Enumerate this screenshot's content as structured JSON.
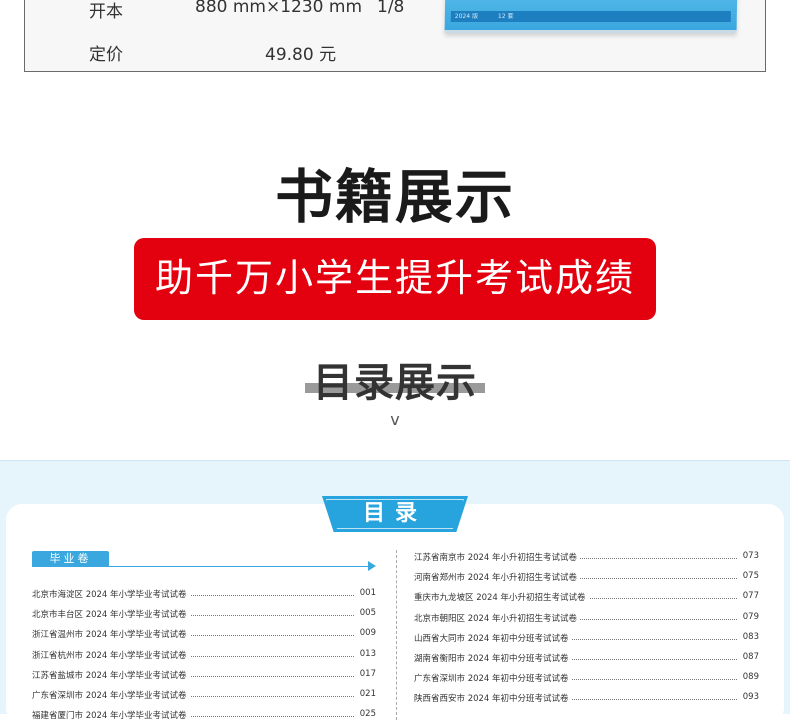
{
  "spec": {
    "rows": [
      {
        "label": "开本",
        "value1": "880 mm×1230 mm",
        "value2": "1/8"
      },
      {
        "label": "定价",
        "value1": "49.80 元"
      }
    ]
  },
  "book_thumb": {
    "strip_text_1": "2024 版",
    "strip_text_2": "12 套"
  },
  "headings": {
    "title": "书籍展示",
    "banner": "助千万小学生提升考试成绩",
    "subtitle": "目录展示",
    "chevron": "v"
  },
  "toc": {
    "badge": "目录",
    "section": "毕业卷",
    "left": [
      {
        "title": "北京市海淀区 2024 年小学毕业考试试卷",
        "page": "001"
      },
      {
        "title": "北京市丰台区 2024 年小学毕业考试试卷",
        "page": "005"
      },
      {
        "title": "浙江省温州市 2024 年小学毕业考试试卷",
        "page": "009"
      },
      {
        "title": "浙江省杭州市 2024 年小学毕业考试试卷",
        "page": "013"
      },
      {
        "title": "江苏省盐城市 2024 年小学毕业考试试卷",
        "page": "017"
      },
      {
        "title": "广东省深圳市 2024 年小学毕业考试试卷",
        "page": "021"
      },
      {
        "title": "福建省厦门市 2024 年小学毕业考试试卷",
        "page": "025"
      }
    ],
    "right": [
      {
        "title": "江苏省南京市 2024 年小升初招生考试试卷",
        "page": "073"
      },
      {
        "title": "河南省郑州市 2024 年小升初招生考试试卷",
        "page": "075"
      },
      {
        "title": "重庆市九龙坡区 2024 年小升初招生考试试卷",
        "page": "077"
      },
      {
        "title": "北京市朝阳区 2024 年小升初招生考试试卷",
        "page": "079"
      },
      {
        "title": "山西省大同市 2024 年初中分班考试试卷",
        "page": "083"
      },
      {
        "title": "湖南省衡阳市 2024 年初中分班考试试卷",
        "page": "087"
      },
      {
        "title": "广东省深圳市 2024 年初中分班考试试卷",
        "page": "089"
      },
      {
        "title": "陕西省西安市 2024 年初中分班考试试卷",
        "page": "093"
      }
    ]
  },
  "colors": {
    "accent": "#27a3dd",
    "banner": "#e3000f",
    "toc_bg": "#e6f4fb"
  }
}
